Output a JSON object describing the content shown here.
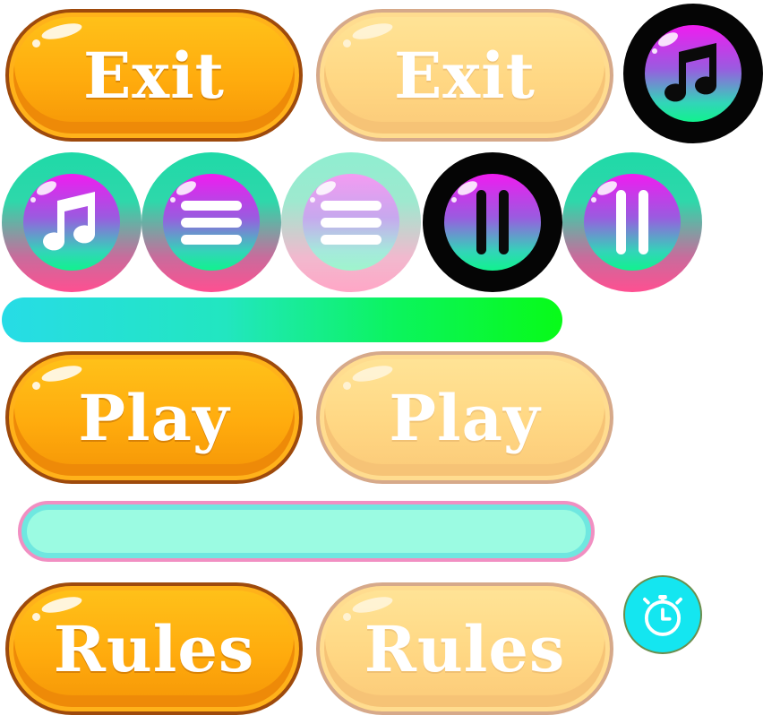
{
  "buttons": {
    "exit_label": "Exit",
    "exit_disabled_label": "Exit",
    "play_label": "Play",
    "play_disabled_label": "Play",
    "rules_label": "Rules",
    "rules_disabled_label": "Rules"
  },
  "icons": {
    "music_dark": "music-note-icon",
    "music_light": "music-note-icon",
    "menu": "menu-icon",
    "menu_disabled": "menu-icon",
    "pause_dark": "pause-icon",
    "pause_light": "pause-icon",
    "timer": "stopwatch-icon"
  },
  "progress": {
    "fill": 1.0
  },
  "colors": {
    "primary_orange": "#ffab0d",
    "disabled_orange": "#ffd783",
    "face_gradient_top": "#f01cf0",
    "face_gradient_bottom": "#11f28e",
    "progress_start": "#27dce6",
    "progress_end": "#08fb18",
    "input_fill": "#9bfbe2",
    "input_border": "#f18fc2",
    "timer_fill": "#14e6f0"
  }
}
